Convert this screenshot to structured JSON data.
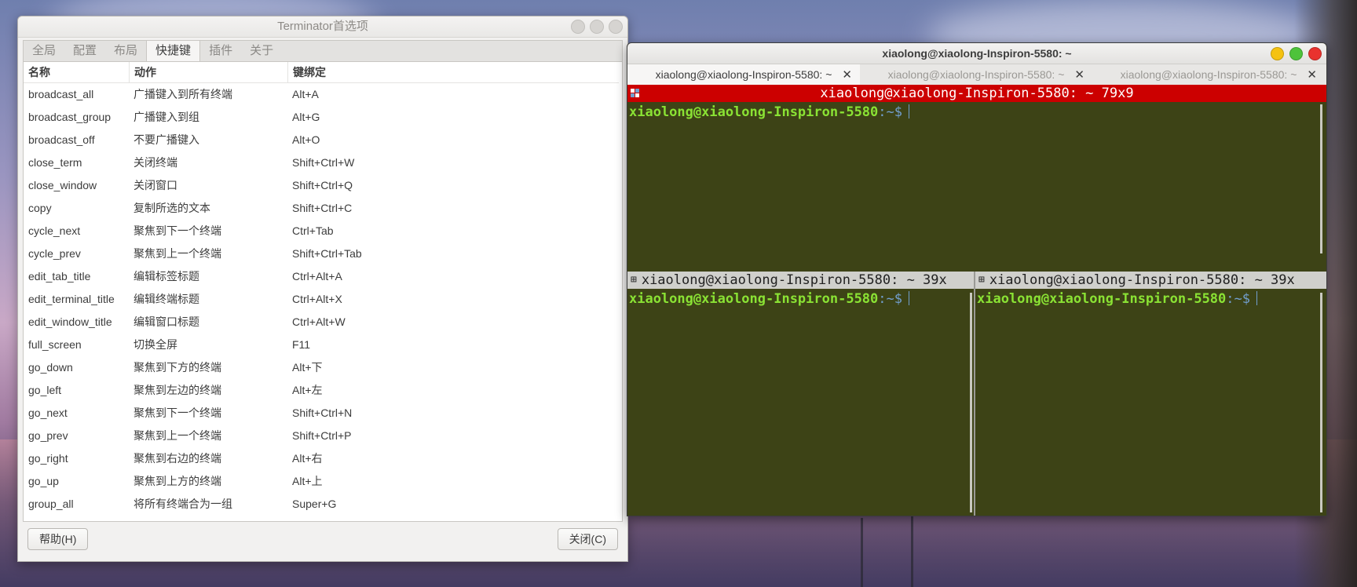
{
  "preferences": {
    "title": "Terminator首选项",
    "tabs": [
      "全局",
      "配置",
      "布局",
      "快捷键",
      "插件",
      "关于"
    ],
    "active_tab": "快捷键",
    "columns": {
      "name": "名称",
      "action": "动作",
      "binding": "键绑定"
    },
    "rows": [
      [
        "broadcast_all",
        "广播键入到所有终端",
        "Alt+A"
      ],
      [
        "broadcast_group",
        "广播键入到组",
        "Alt+G"
      ],
      [
        "broadcast_off",
        "不要广播键入",
        "Alt+O"
      ],
      [
        "close_term",
        "关闭终端",
        "Shift+Ctrl+W"
      ],
      [
        "close_window",
        "关闭窗口",
        "Shift+Ctrl+Q"
      ],
      [
        "copy",
        "复制所选的文本",
        "Shift+Ctrl+C"
      ],
      [
        "cycle_next",
        "聚焦到下一个终端",
        "Ctrl+Tab"
      ],
      [
        "cycle_prev",
        "聚焦到上一个终端",
        "Shift+Ctrl+Tab"
      ],
      [
        "edit_tab_title",
        "编辑标签标题",
        "Ctrl+Alt+A"
      ],
      [
        "edit_terminal_title",
        "编辑终端标题",
        "Ctrl+Alt+X"
      ],
      [
        "edit_window_title",
        "编辑窗口标题",
        "Ctrl+Alt+W"
      ],
      [
        "full_screen",
        "切换全屏",
        "F11"
      ],
      [
        "go_down",
        "聚焦到下方的终端",
        "Alt+下"
      ],
      [
        "go_left",
        "聚焦到左边的终端",
        "Alt+左"
      ],
      [
        "go_next",
        "聚焦到下一个终端",
        "Shift+Ctrl+N"
      ],
      [
        "go_prev",
        "聚焦到上一个终端",
        "Shift+Ctrl+P"
      ],
      [
        "go_right",
        "聚焦到右边的终端",
        "Alt+右"
      ],
      [
        "go_up",
        "聚焦到上方的终端",
        "Alt+上"
      ],
      [
        "group_all",
        "将所有终端合为一组",
        "Super+G"
      ]
    ],
    "help_button": "帮助(H)",
    "close_button": "关闭(C)"
  },
  "terminal": {
    "window_title": "xiaolong@xiaolong-Inspiron-5580: ~",
    "tabs": [
      {
        "label": "xiaolong@xiaolong-Inspiron-5580: ~",
        "active": true
      },
      {
        "label": "xiaolong@xiaolong-Inspiron-5580: ~",
        "active": false
      },
      {
        "label": "xiaolong@xiaolong-Inspiron-5580: ~",
        "active": false
      }
    ],
    "tab_close_glyph": "✕",
    "pane_top_title": "xiaolong@xiaolong-Inspiron-5580: ~ 79x9",
    "pane_left_title": "xiaolong@xiaolong-Inspiron-5580: ~ 39x",
    "pane_right_title": "xiaolong@xiaolong-Inspiron-5580: ~ 39x",
    "prompt_user": "xiaolong@xiaolong-Inspiron-5580",
    "prompt_path": ":~$",
    "colors": {
      "background": "#3d4316",
      "focused_titlebar": "#cc0000",
      "inactive_titlebar": "#d0d0cc",
      "prompt_user": "#8ae234",
      "prompt_path": "#729fcf"
    }
  },
  "icons": [
    "pane-grid-icon",
    "window-close-icon",
    "window-minimize-icon",
    "window-maximize-icon",
    "tab-close-icon"
  ]
}
